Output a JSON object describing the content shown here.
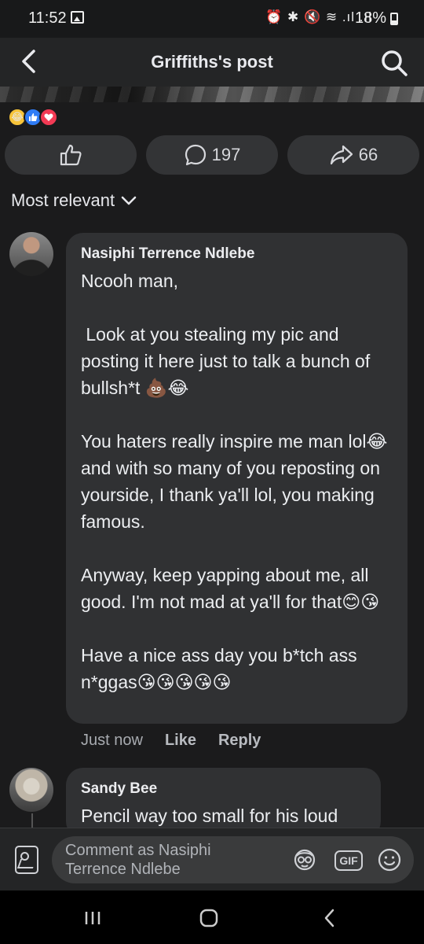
{
  "status_bar": {
    "time": "11:52",
    "icons": "⏰ ✱ 🔇 ≋ .ıl .ıl",
    "battery": "18%"
  },
  "header": {
    "title": "Griffiths's post"
  },
  "actions": {
    "comment_count": "197",
    "share_count": "66"
  },
  "sort_label": "Most relevant",
  "comments": [
    {
      "author": "Nasiphi Terrence Ndlebe",
      "text": "Ncooh man,\n\n Look at you stealing my pic and posting it here just to talk a bunch of bullsh*t 💩😂\n\nYou haters really inspire me man lol😂 and with so many of you reposting on yourside, I thank ya'll lol, you making famous.\n\nAnyway, keep yapping about me, all good. I'm not mad at ya'll for that😊😘\n\nHave a nice ass day you b*tch ass n*ggas😘😘😘😘😘",
      "time": "Just now",
      "like_label": "Like",
      "reply_label": "Reply"
    },
    {
      "author": "Sandy Bee",
      "text": "Pencil way too small for his loud"
    }
  ],
  "composer": {
    "placeholder": "Comment as Nasiphi Terrence Ndlebe",
    "gif_label": "GIF"
  },
  "colors": {
    "background": "#1b1b1c",
    "bubble": "#303133",
    "header": "#242526"
  }
}
